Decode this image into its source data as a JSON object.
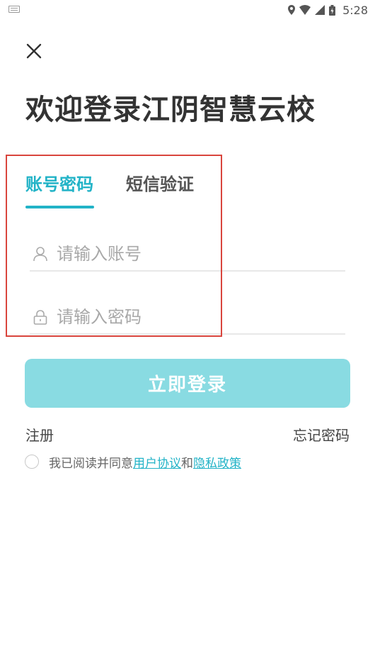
{
  "status_bar": {
    "time": "5:28",
    "icons": [
      "keyboard-icon",
      "location-icon",
      "wifi-icon",
      "signal-icon",
      "battery-icon"
    ]
  },
  "header": {
    "close_icon": "close-icon",
    "title": "欢迎登录江阴智慧云校"
  },
  "tabs": [
    {
      "label": "账号密码",
      "active": true
    },
    {
      "label": "短信验证",
      "active": false
    }
  ],
  "form": {
    "account": {
      "placeholder": "请输入账号",
      "value": "",
      "icon": "user-icon"
    },
    "password": {
      "placeholder": "请输入密码",
      "value": "",
      "icon": "lock-icon"
    },
    "login_label": "立即登录"
  },
  "links": {
    "register": "注册",
    "forgot": "忘记密码"
  },
  "agreement": {
    "checked": false,
    "prefix": "我已阅读并同意",
    "user_agreement": "用户协议",
    "conjunction": "和",
    "privacy_policy": "隐私政策"
  },
  "colors": {
    "accent": "#22b3c7",
    "button_bg": "#89dbe2",
    "highlight_border": "#d9453d",
    "title_text": "#333333"
  }
}
